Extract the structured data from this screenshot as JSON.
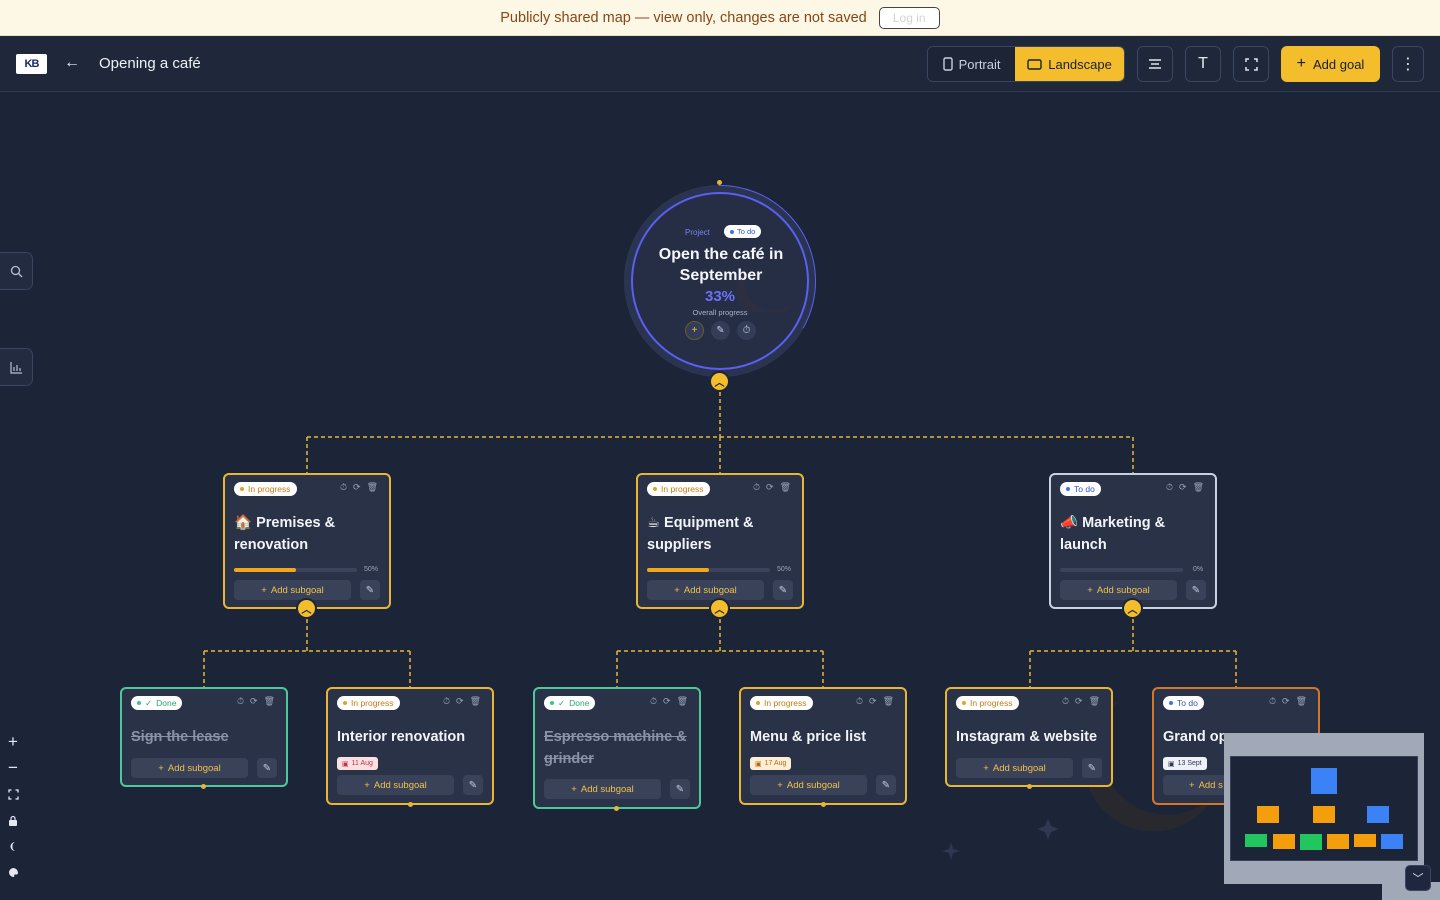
{
  "banner": {
    "text": "Publicly shared map — view only, changes are not saved",
    "login": "Log in"
  },
  "header": {
    "logo": "KB",
    "title": "Opening a café",
    "portrait": "Portrait",
    "landscape": "Landscape",
    "add_goal": "Add goal"
  },
  "root": {
    "kind": "Project",
    "status": "To do",
    "title": "Open the café in September",
    "progress": "33%",
    "progress_label": "Overall progress",
    "progress_value": 0.33
  },
  "goals": [
    {
      "emoji": "🏠",
      "title": "Premises & renovation",
      "status": "In progress",
      "progress": "50%",
      "progress_value": 0.5,
      "add": "Add subgoal"
    },
    {
      "emoji": "☕",
      "title": "Equipment & suppliers",
      "status": "In progress",
      "progress": "50%",
      "progress_value": 0.5,
      "add": "Add subgoal"
    },
    {
      "emoji": "📣",
      "title": "Marketing & launch",
      "status": "To do",
      "progress": "0%",
      "progress_value": 0,
      "add": "Add subgoal"
    }
  ],
  "subgoals": [
    {
      "title": "Sign the lease",
      "status": "Done",
      "add": "Add subgoal"
    },
    {
      "title": "Interior renovation",
      "status": "In progress",
      "date": "11 Aug",
      "add": "Add subgoal"
    },
    {
      "title": "Espresso machine & grinder",
      "status": "Done",
      "add": "Add subgoal"
    },
    {
      "title": "Menu & price list",
      "status": "In progress",
      "date": "17 Aug",
      "add": "Add subgoal"
    },
    {
      "title": "Instagram & website",
      "status": "In progress",
      "add": "Add subgoal"
    },
    {
      "title": "Grand opening",
      "title_visible": "Grand op",
      "status": "To do",
      "date": "13 Sept",
      "add": "Add s"
    }
  ],
  "colors": {
    "accent": "#f4bd2b",
    "done": "#4ec79a",
    "todo": "#3d73e8",
    "project": "#5b5ff0"
  }
}
